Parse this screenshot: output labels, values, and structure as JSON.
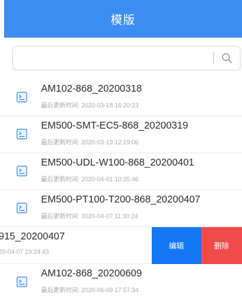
{
  "header": {
    "title": "模版"
  },
  "search": {
    "placeholder": "",
    "value": ""
  },
  "items": [
    {
      "name": "AM102-868_20200318",
      "updated_label": "最后更新时间:",
      "updated": "2020-03-18 16:20:23"
    },
    {
      "name": "EM500-SMT-EC5-868_20200319",
      "updated_label": "最后更新时间:",
      "updated": "2020-03-19 12:19:06"
    },
    {
      "name": "EM500-UDL-W100-868_20200401",
      "updated_label": "最后更新时间:",
      "updated": "2020-04-01 10:25:46"
    },
    {
      "name": "EM500-PT100-T200-868_20200407",
      "updated_label": "最后更新时间:",
      "updated": "2020-04-07 11:30:24"
    },
    {
      "name": "915_20200407",
      "updated_label": "",
      "updated": "20-04-07 19:24:43"
    },
    {
      "name": "AM102-868_20200609",
      "updated_label": "最后更新时间:",
      "updated": "2020-06-09 17:57:34"
    }
  ],
  "actions": {
    "edit": "编辑",
    "delete": "删除"
  },
  "colors": {
    "header": "#3d8df2",
    "edit": "#1677f2",
    "delete": "#f04a4a"
  },
  "icons": {
    "search": "search-icon",
    "file": "file-icon"
  }
}
